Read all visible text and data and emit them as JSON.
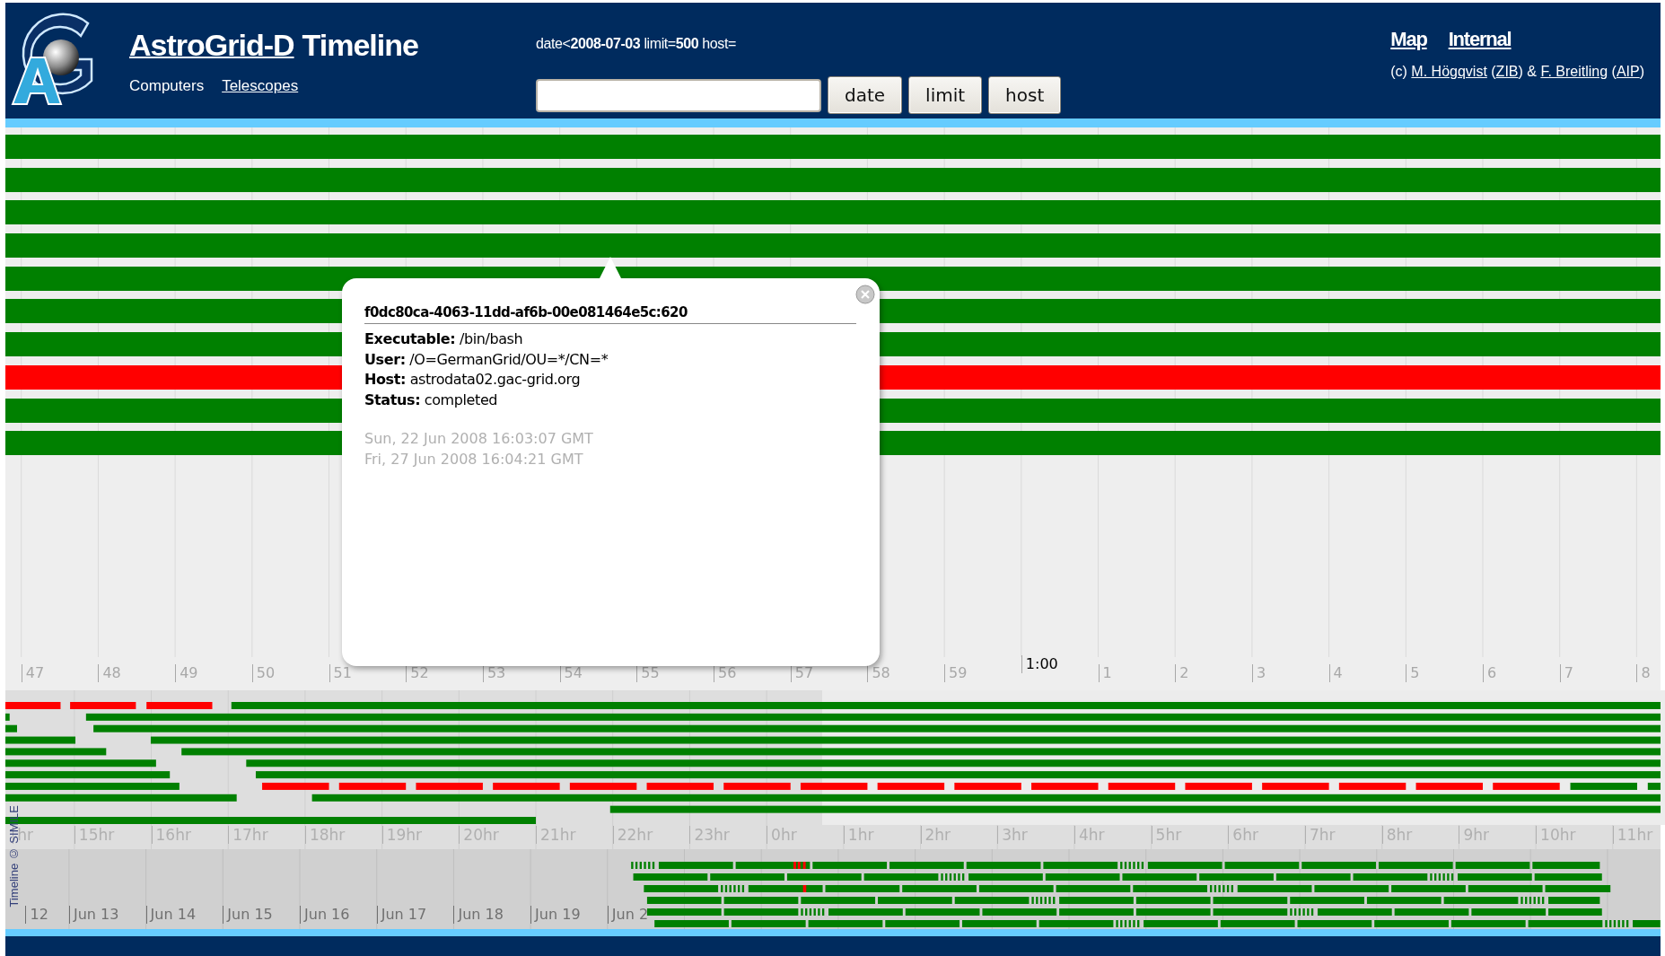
{
  "header": {
    "title_link": "AstroGrid-D",
    "title": "Timeline",
    "nav": [
      {
        "label": "Computers",
        "link": false
      },
      {
        "label": "Telescopes",
        "link": true
      }
    ],
    "query": "date<**2008-07-03** limit=**500** host=",
    "buttons": [
      "date",
      "limit",
      "host"
    ],
    "links": [
      "Map",
      "Internal"
    ],
    "credit": [
      {
        "text": "(c) "
      },
      {
        "link": "M. Högqvist"
      },
      {
        "text": " ("
      },
      {
        "link": "ZIB"
      },
      {
        "text": ") & "
      },
      {
        "link": "F. Breitling"
      },
      {
        "text": " ("
      },
      {
        "link": "AIP"
      },
      {
        "text": ")"
      }
    ]
  },
  "timeline": {
    "events": [
      {
        "color": "#008000"
      },
      {
        "color": "#008000"
      },
      {
        "color": "#008000"
      },
      {
        "color": "#008000"
      },
      {
        "color": "#008000"
      },
      {
        "color": "#008000"
      },
      {
        "color": "#008000"
      },
      {
        "color": "#ff0000"
      },
      {
        "color": "#008000"
      },
      {
        "color": "#008000"
      }
    ],
    "minute_ticks": [
      {
        "label": "47",
        "kind": "minor"
      },
      {
        "label": "48",
        "kind": "minor"
      },
      {
        "label": "49",
        "kind": "minor"
      },
      {
        "label": "50",
        "kind": "minor"
      },
      {
        "label": "51",
        "kind": "minor"
      },
      {
        "label": "52",
        "kind": "minor"
      },
      {
        "label": "53",
        "kind": "minor"
      },
      {
        "label": "54",
        "kind": "minor"
      },
      {
        "label": "55",
        "kind": "minor"
      },
      {
        "label": "56",
        "kind": "minor"
      },
      {
        "label": "57",
        "kind": "minor"
      },
      {
        "label": "58",
        "kind": "minor"
      },
      {
        "label": "59",
        "kind": "minor"
      },
      {
        "label": "1:00",
        "kind": "major"
      },
      {
        "label": "1",
        "kind": "minor"
      },
      {
        "label": "2",
        "kind": "minor"
      },
      {
        "label": "3",
        "kind": "minor"
      },
      {
        "label": "4",
        "kind": "minor"
      },
      {
        "label": "5",
        "kind": "minor"
      },
      {
        "label": "6",
        "kind": "minor"
      },
      {
        "label": "7",
        "kind": "minor"
      },
      {
        "label": "8",
        "kind": "minor"
      }
    ],
    "popup": {
      "title": "f0dc80ca-4063-11dd-af6b-00e081464e5c:620",
      "fields": [
        {
          "label": "Executable:",
          "value": "/bin/bash"
        },
        {
          "label": "User:",
          "value": "/O=GermanGrid/OU=*/CN=*"
        },
        {
          "label": "Host:",
          "value": "astrodata02.gac-grid.org"
        },
        {
          "label": "Status:",
          "value": "completed"
        }
      ],
      "start": "Sun, 22 Jun 2008 16:03:07 GMT",
      "end": "Fri, 27 Jun 2008 16:04:21 GMT"
    },
    "hour_ticks": [
      "hr",
      "15hr",
      "16hr",
      "17hr",
      "18hr",
      "19hr",
      "20hr",
      "21hr",
      "22hr",
      "23hr",
      "0hr",
      "1hr",
      "2hr",
      "3hr",
      "4hr",
      "5hr",
      "6hr",
      "7hr",
      "8hr",
      "9hr",
      "10hr",
      "11hr"
    ],
    "day_ticks": [
      "12",
      "Jun 13",
      "Jun 14",
      "Jun 15",
      "Jun 16",
      "Jun 17",
      "Jun 18",
      "Jun 19",
      "Jun 2"
    ],
    "credit": "Timeline © SIMILE"
  }
}
